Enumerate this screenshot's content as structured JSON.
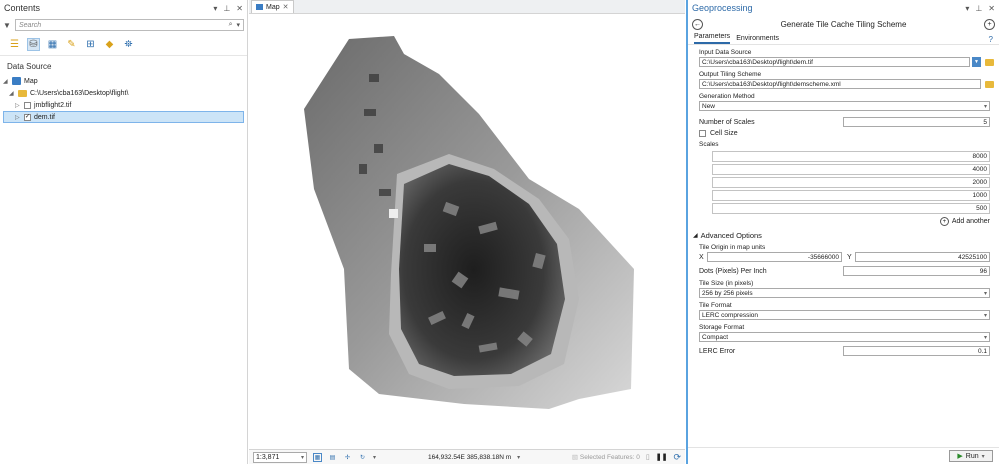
{
  "contents": {
    "title": "Contents",
    "search_placeholder": "Search",
    "section_label": "Data Source",
    "tree": {
      "map": "Map",
      "folder": "C:\\Users\\cba163\\Desktop\\flight\\",
      "layer1": "jmbflight2.tif",
      "layer2": "dem.tif"
    }
  },
  "mapview": {
    "tab_label": "Map",
    "scale": "1:3,871",
    "coordinates": "164,932.54E 385,838.18N m",
    "selected_features": "Selected Features: 0"
  },
  "geo": {
    "pane_title": "Geoprocessing",
    "tool_name": "Generate Tile Cache Tiling Scheme",
    "tab_parameters": "Parameters",
    "tab_environments": "Environments",
    "input_label": "Input Data Source",
    "input_value": "C:\\Users\\cba163\\Desktop\\flight\\dem.tif",
    "output_label": "Output Tiling Scheme",
    "output_value": "C:\\Users\\cba163\\Desktop\\flight\\demscheme.xml",
    "method_label": "Generation Method",
    "method_value": "New",
    "num_scales_label": "Number of Scales",
    "num_scales_value": "5",
    "cell_size_label": "Cell Size",
    "scales_label": "Scales",
    "scales": [
      "8000",
      "4000",
      "2000",
      "1000",
      "500"
    ],
    "add_another": "Add another",
    "advanced_label": "Advanced Options",
    "origin_label": "Tile Origin in map units",
    "x_label": "X",
    "x_value": "-35666000",
    "y_label": "Y",
    "y_value": "42525100",
    "dpi_label": "Dots (Pixels) Per Inch",
    "dpi_value": "96",
    "tile_size_label": "Tile Size (in pixels)",
    "tile_size_value": "256 by 256 pixels",
    "tile_format_label": "Tile Format",
    "tile_format_value": "LERC compression",
    "storage_label": "Storage Format",
    "storage_value": "Compact",
    "lerc_label": "LERC Error",
    "lerc_value": "0.1",
    "run_label": "Run"
  }
}
